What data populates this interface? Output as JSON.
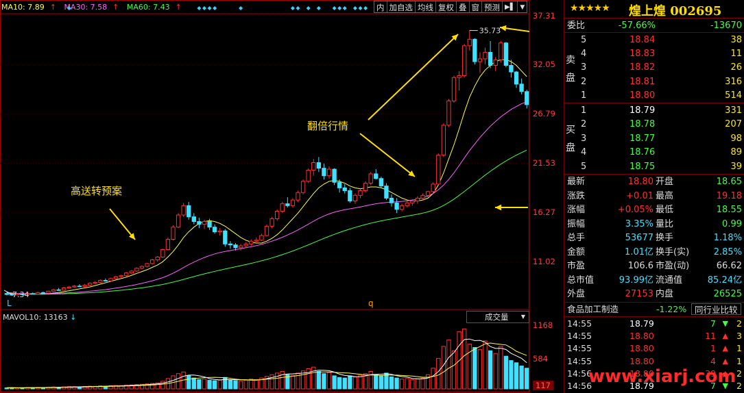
{
  "chart": {
    "ma_legend": [
      {
        "label": "MA10: 7.89",
        "arrow": "↑",
        "color": "#ffff40"
      },
      {
        "label": "MA30: 7.58",
        "arrow": "↑",
        "color": "#ff60ff"
      },
      {
        "label": "MA60: 7.43",
        "arrow": "↑",
        "color": "#40ff40"
      }
    ],
    "toolbar": [
      "内",
      "加自选",
      "均线",
      "复权",
      "叠",
      "窗",
      "预测"
    ],
    "yaxis": [
      {
        "label": "37.31",
        "y": 23
      },
      {
        "label": "32.05",
        "y": 94
      },
      {
        "label": "26.79",
        "y": 166
      },
      {
        "label": "21.53",
        "y": 238
      },
      {
        "label": "16.27",
        "y": 310
      },
      {
        "label": "11.02",
        "y": 382
      }
    ],
    "high_label": "35.73",
    "low_label": "7.34",
    "x_marks": [
      "L",
      "q"
    ],
    "annotations": {
      "a1": "高送转预案",
      "a2": "翻倍行情"
    }
  },
  "chart_data": {
    "type": "candlestick",
    "ylim": [
      5.5,
      37.31
    ],
    "price_ticks": [
      37.31,
      32.05,
      26.79,
      21.53,
      16.27,
      11.02
    ],
    "ohlc": [
      [
        7.6,
        7.7,
        7.4,
        7.5
      ],
      [
        7.5,
        7.6,
        7.34,
        7.45
      ],
      [
        7.45,
        7.6,
        7.4,
        7.55
      ],
      [
        7.55,
        7.6,
        7.4,
        7.5
      ],
      [
        7.5,
        7.7,
        7.45,
        7.6
      ],
      [
        7.6,
        7.7,
        7.5,
        7.55
      ],
      [
        7.55,
        7.8,
        7.5,
        7.7
      ],
      [
        7.7,
        7.8,
        7.6,
        7.65
      ],
      [
        7.65,
        7.9,
        7.6,
        7.85
      ],
      [
        7.85,
        8.1,
        7.8,
        8.0
      ],
      [
        8.0,
        8.2,
        7.9,
        7.95
      ],
      [
        7.95,
        8.3,
        7.9,
        8.2
      ],
      [
        8.2,
        8.4,
        8.1,
        8.3
      ],
      [
        8.3,
        8.5,
        8.2,
        8.4
      ],
      [
        8.4,
        8.6,
        8.3,
        8.35
      ],
      [
        8.35,
        8.6,
        8.3,
        8.5
      ],
      [
        8.5,
        8.8,
        8.4,
        8.7
      ],
      [
        8.7,
        8.9,
        8.6,
        8.8
      ],
      [
        8.8,
        9.1,
        8.7,
        9.0
      ],
      [
        9.0,
        9.2,
        8.9,
        8.95
      ],
      [
        8.95,
        9.3,
        8.9,
        9.2
      ],
      [
        9.2,
        9.5,
        9.1,
        9.4
      ],
      [
        9.4,
        9.6,
        9.3,
        9.5
      ],
      [
        9.5,
        9.9,
        9.4,
        9.8
      ],
      [
        9.8,
        10.1,
        9.7,
        10.0
      ],
      [
        10.0,
        10.4,
        9.9,
        10.3
      ],
      [
        10.3,
        10.6,
        10.2,
        10.5
      ],
      [
        10.5,
        10.9,
        10.4,
        10.8
      ],
      [
        10.8,
        11.3,
        10.7,
        11.2
      ],
      [
        11.2,
        11.6,
        11.0,
        11.5
      ],
      [
        11.5,
        12.4,
        11.4,
        12.3
      ],
      [
        12.3,
        13.6,
        12.2,
        13.4
      ],
      [
        13.4,
        14.9,
        13.3,
        14.7
      ],
      [
        14.7,
        16.2,
        14.6,
        16.0
      ],
      [
        16.0,
        17.3,
        15.8,
        17.0
      ],
      [
        17.0,
        17.4,
        15.5,
        15.8
      ],
      [
        15.8,
        16.2,
        15.0,
        15.3
      ],
      [
        15.3,
        15.7,
        14.6,
        15.0
      ],
      [
        15.0,
        15.5,
        14.5,
        15.3
      ],
      [
        15.3,
        15.6,
        14.4,
        14.7
      ],
      [
        14.7,
        15.0,
        14.0,
        14.2
      ],
      [
        14.2,
        14.6,
        13.8,
        14.3
      ],
      [
        14.3,
        14.5,
        12.6,
        12.9
      ],
      [
        12.9,
        13.2,
        12.4,
        12.8
      ],
      [
        12.8,
        13.0,
        12.2,
        12.5
      ],
      [
        12.5,
        12.9,
        12.2,
        12.7
      ],
      [
        12.7,
        13.1,
        12.5,
        12.9
      ],
      [
        12.9,
        13.4,
        12.7,
        13.2
      ],
      [
        13.2,
        13.6,
        13.0,
        13.3
      ],
      [
        13.3,
        14.0,
        13.2,
        13.8
      ],
      [
        13.8,
        15.0,
        13.7,
        14.8
      ],
      [
        14.8,
        15.8,
        14.6,
        15.6
      ],
      [
        15.6,
        16.6,
        15.4,
        16.4
      ],
      [
        16.4,
        17.4,
        16.2,
        17.2
      ],
      [
        17.2,
        17.9,
        16.8,
        17.0
      ],
      [
        17.0,
        17.8,
        16.8,
        17.6
      ],
      [
        17.6,
        18.6,
        17.4,
        18.4
      ],
      [
        18.4,
        19.8,
        18.2,
        19.6
      ],
      [
        19.6,
        21.0,
        19.4,
        20.8
      ],
      [
        20.8,
        22.0,
        20.2,
        21.6
      ],
      [
        21.6,
        22.2,
        20.6,
        21.0
      ],
      [
        21.0,
        21.5,
        19.8,
        20.2
      ],
      [
        20.2,
        21.2,
        19.9,
        20.9
      ],
      [
        20.9,
        21.0,
        19.2,
        19.5
      ],
      [
        19.5,
        19.8,
        18.4,
        18.9
      ],
      [
        18.9,
        19.3,
        18.3,
        18.6
      ],
      [
        18.6,
        18.9,
        17.3,
        17.5
      ],
      [
        17.5,
        18.3,
        17.2,
        18.1
      ],
      [
        18.1,
        18.8,
        17.8,
        18.6
      ],
      [
        18.6,
        19.6,
        18.4,
        19.4
      ],
      [
        19.4,
        20.6,
        19.2,
        20.4
      ],
      [
        20.4,
        20.9,
        19.8,
        19.9
      ],
      [
        19.9,
        20.1,
        18.9,
        19.1
      ],
      [
        19.1,
        19.4,
        17.6,
        17.8
      ],
      [
        17.8,
        18.2,
        16.9,
        17.3
      ],
      [
        17.3,
        17.8,
        16.2,
        16.6
      ],
      [
        16.6,
        17.2,
        16.4,
        17.0
      ],
      [
        17.0,
        17.6,
        16.8,
        17.3
      ],
      [
        17.3,
        17.7,
        17.0,
        17.5
      ],
      [
        17.5,
        18.0,
        17.2,
        17.8
      ],
      [
        17.8,
        18.3,
        17.6,
        18.1
      ],
      [
        18.1,
        18.6,
        17.9,
        18.5
      ],
      [
        18.5,
        19.5,
        18.4,
        19.3
      ],
      [
        19.3,
        22.6,
        19.2,
        22.4
      ],
      [
        22.4,
        25.8,
        22.2,
        25.6
      ],
      [
        25.6,
        28.4,
        25.4,
        28.2
      ],
      [
        28.2,
        30.9,
        28.0,
        30.7
      ],
      [
        30.7,
        31.4,
        29.3,
        30.9
      ],
      [
        30.9,
        34.3,
        30.7,
        34.1
      ],
      [
        34.1,
        35.73,
        33.6,
        34.8
      ],
      [
        34.8,
        34.9,
        32.1,
        32.4
      ],
      [
        32.4,
        33.4,
        31.2,
        32.7
      ],
      [
        32.7,
        33.9,
        32.1,
        33.4
      ],
      [
        33.4,
        34.6,
        31.7,
        32.0
      ],
      [
        32.0,
        32.9,
        31.4,
        32.6
      ],
      [
        32.6,
        34.6,
        32.3,
        34.4
      ],
      [
        34.4,
        34.5,
        31.8,
        32.0
      ],
      [
        32.0,
        32.6,
        30.7,
        31.3
      ],
      [
        31.3,
        31.4,
        29.6,
        30.0
      ],
      [
        30.0,
        30.6,
        28.9,
        29.2
      ],
      [
        29.2,
        29.4,
        27.4,
        27.8
      ]
    ],
    "ma_series": [
      {
        "name": "MA10",
        "color": "#ffff40",
        "values": [
          7.7,
          7.65,
          7.6,
          7.58,
          7.56,
          7.55,
          7.56,
          7.58,
          7.6,
          7.65,
          7.7,
          7.8,
          7.9,
          8.0,
          8.1,
          8.2,
          8.3,
          8.45,
          8.6,
          8.75,
          8.9,
          9.05,
          9.2,
          9.35,
          9.55,
          9.75,
          9.95,
          10.15,
          10.4,
          10.65,
          11.0,
          11.5,
          12.1,
          12.8,
          13.6,
          14.2,
          14.7,
          15.1,
          15.3,
          15.4,
          15.3,
          15.1,
          14.8,
          14.4,
          14.0,
          13.6,
          13.3,
          13.1,
          13.0,
          13.0,
          13.2,
          13.5,
          13.9,
          14.4,
          15.0,
          15.6,
          16.2,
          16.9,
          17.6,
          18.3,
          18.9,
          19.3,
          19.6,
          19.7,
          19.6,
          19.4,
          19.1,
          18.9,
          18.8,
          18.9,
          19.0,
          19.0,
          18.9,
          18.7,
          18.4,
          18.1,
          17.8,
          17.6,
          17.5,
          17.5,
          17.6,
          17.8,
          18.3,
          19.2,
          20.5,
          22.0,
          23.5,
          25.2,
          27.0,
          28.6,
          29.8,
          30.8,
          31.5,
          32.0,
          32.4,
          32.6,
          32.6,
          32.4,
          32.0,
          31.4,
          30.8
        ]
      },
      {
        "name": "MA30",
        "color": "#ff60ff",
        "values": [
          7.6,
          7.6,
          7.6,
          7.59,
          7.58,
          7.58,
          7.58,
          7.59,
          7.6,
          7.61,
          7.63,
          7.65,
          7.68,
          7.71,
          7.75,
          7.8,
          7.85,
          7.9,
          7.96,
          8.02,
          8.1,
          8.18,
          8.27,
          8.36,
          8.46,
          8.57,
          8.69,
          8.82,
          8.96,
          9.12,
          9.3,
          9.52,
          9.78,
          10.07,
          10.38,
          10.68,
          10.96,
          11.22,
          11.45,
          11.66,
          11.84,
          11.99,
          12.1,
          12.2,
          12.3,
          12.4,
          12.5,
          12.6,
          12.72,
          12.86,
          13.02,
          13.2,
          13.4,
          13.62,
          13.86,
          14.12,
          14.4,
          14.7,
          15.02,
          15.34,
          15.64,
          15.9,
          16.12,
          16.3,
          16.44,
          16.56,
          16.66,
          16.76,
          16.86,
          16.98,
          17.1,
          17.2,
          17.28,
          17.34,
          17.38,
          17.42,
          17.46,
          17.52,
          17.6,
          17.7,
          17.84,
          18.02,
          18.3,
          18.7,
          19.2,
          19.8,
          20.5,
          21.3,
          22.1,
          22.9,
          23.6,
          24.3,
          24.9,
          25.5,
          26.0,
          26.5,
          26.9,
          27.3,
          27.6,
          27.9,
          28.1
        ]
      },
      {
        "name": "MA60",
        "color": "#40ff40",
        "values": [
          7.55,
          7.55,
          7.55,
          7.54,
          7.53,
          7.53,
          7.53,
          7.53,
          7.54,
          7.55,
          7.56,
          7.57,
          7.59,
          7.61,
          7.63,
          7.66,
          7.69,
          7.72,
          7.76,
          7.8,
          7.85,
          7.9,
          7.95,
          8.01,
          8.07,
          8.14,
          8.21,
          8.29,
          8.38,
          8.47,
          8.57,
          8.69,
          8.82,
          8.96,
          9.11,
          9.26,
          9.41,
          9.56,
          9.7,
          9.84,
          9.97,
          10.1,
          10.22,
          10.34,
          10.46,
          10.58,
          10.7,
          10.83,
          10.96,
          11.1,
          11.25,
          11.41,
          11.58,
          11.76,
          11.95,
          12.15,
          12.36,
          12.58,
          12.81,
          13.04,
          13.27,
          13.5,
          13.72,
          13.93,
          14.13,
          14.32,
          14.5,
          14.67,
          14.83,
          14.98,
          15.12,
          15.25,
          15.37,
          15.48,
          15.58,
          15.68,
          15.78,
          15.88,
          15.98,
          16.08,
          16.2,
          16.34,
          16.52,
          16.75,
          17.02,
          17.34,
          17.7,
          18.1,
          18.52,
          18.96,
          19.4,
          19.84,
          20.27,
          20.68,
          21.07,
          21.44,
          21.78,
          22.1,
          22.4,
          22.68,
          22.94
        ]
      }
    ],
    "volume": {
      "ylim": [
        0,
        1168
      ],
      "ticks": [
        1168,
        584,
        117
      ],
      "values": [
        20,
        22,
        18,
        20,
        25,
        22,
        28,
        25,
        30,
        35,
        30,
        38,
        42,
        40,
        38,
        45,
        50,
        48,
        55,
        50,
        58,
        62,
        60,
        68,
        72,
        80,
        85,
        92,
        100,
        110,
        140,
        190,
        240,
        280,
        310,
        240,
        200,
        170,
        180,
        160,
        150,
        160,
        210,
        170,
        150,
        140,
        160,
        180,
        170,
        200,
        230,
        260,
        290,
        320,
        260,
        250,
        290,
        330,
        370,
        400,
        320,
        280,
        300,
        240,
        210,
        200,
        240,
        220,
        250,
        280,
        320,
        260,
        240,
        290,
        220,
        200,
        180,
        190,
        170,
        180,
        200,
        260,
        380,
        560,
        780,
        900,
        700,
        1050,
        1100,
        820,
        760,
        720,
        880,
        700,
        650,
        780,
        600,
        520,
        480,
        420,
        380
      ],
      "ma_vol": "13163"
    }
  },
  "vol": {
    "legend": "MAVOL10: 13163",
    "arrow": "↓",
    "dropdown": "成交量",
    "arrowdd": "▼"
  },
  "quote": {
    "stars": "★★★★★",
    "name": "煌上煌 002695",
    "weibi": {
      "label": "委比",
      "pct": "-57.66%",
      "val": "-13670"
    },
    "sell_label": [
      "卖",
      "盘"
    ],
    "buy_label": [
      "买",
      "盘"
    ],
    "sell": [
      {
        "n": "5",
        "p": "18.84",
        "v": "38"
      },
      {
        "n": "4",
        "p": "18.83",
        "v": "11"
      },
      {
        "n": "3",
        "p": "18.82",
        "v": "26"
      },
      {
        "n": "2",
        "p": "18.81",
        "v": "316"
      },
      {
        "n": "1",
        "p": "18.80",
        "v": "514"
      }
    ],
    "buy": [
      {
        "n": "1",
        "p": "18.79",
        "v": "331"
      },
      {
        "n": "2",
        "p": "18.78",
        "v": "207"
      },
      {
        "n": "3",
        "p": "18.77",
        "v": "98"
      },
      {
        "n": "4",
        "p": "18.76",
        "v": "89"
      },
      {
        "n": "5",
        "p": "18.75",
        "v": "39"
      }
    ],
    "stats": [
      {
        "l1": "最新",
        "v1": "18.80",
        "c1": "#ff3030",
        "l2": "开盘",
        "v2": "18.65",
        "c2": "#40ff40"
      },
      {
        "l1": "涨跌",
        "v1": "+0.01",
        "c1": "#ff3030",
        "l2": "最高",
        "v2": "19.18",
        "c2": "#ff3030"
      },
      {
        "l1": "涨幅",
        "v1": "+0.05%",
        "c1": "#ff3030",
        "l2": "最低",
        "v2": "18.55",
        "c2": "#40ff40"
      },
      {
        "l1": "振幅",
        "v1": "3.35%",
        "c1": "#40e0ff",
        "l2": "量比",
        "v2": "0.99",
        "c2": "#40ff40"
      },
      {
        "l1": "总手",
        "v1": "53677",
        "c1": "#40e0ff",
        "l2": "换手",
        "v2": "1.18%",
        "c2": "#40e0ff"
      },
      {
        "l1": "金额",
        "v1": "1.01亿",
        "c1": "#40e0ff",
        "l2": "换手(实)",
        "v2": "2.85%",
        "c2": "#40e0ff"
      },
      {
        "l1": "市盈",
        "v1": "106.6",
        "c1": "#dddddd",
        "l2": "市盈(动)",
        "v2": "66.62",
        "c2": "#dddddd"
      },
      {
        "l1": "总市值",
        "v1": "93.99亿",
        "c1": "#40e0ff",
        "l2": "流通值",
        "v2": "85.24亿",
        "c2": "#40e0ff"
      },
      {
        "l1": "外盘",
        "v1": "27153",
        "c1": "#ff3030",
        "l2": "内盘",
        "v2": "26525",
        "c2": "#40ff40"
      }
    ],
    "industry": {
      "name": "食品加工制造",
      "pct": "-1.22%",
      "compare": "同行业比较"
    },
    "ticks": [
      {
        "t": "14:55",
        "p": "18.79",
        "pc": "#ffffff",
        "v": "7",
        "dir": "down",
        "n": "2"
      },
      {
        "t": "14:55",
        "p": "18.80",
        "pc": "#ff3030",
        "v": "11",
        "dir": "up",
        "n": "3"
      },
      {
        "t": "14:55",
        "p": "18.80",
        "pc": "#ff3030",
        "v": "1",
        "dir": "up",
        "n": "1"
      },
      {
        "t": "14:55",
        "p": "18.80",
        "pc": "#ff3030",
        "v": "4",
        "dir": "up",
        "n": "1"
      },
      {
        "t": "14:56",
        "p": "18.80",
        "pc": "#ff3030",
        "v": "39",
        "dir": "up",
        "n": "2"
      },
      {
        "t": "14:56",
        "p": "18.79",
        "pc": "#ffffff",
        "v": "7",
        "dir": "down",
        "n": "2"
      }
    ]
  },
  "watermark": "www.xiarj.com",
  "colors": {
    "up": "#ff3030",
    "down": "#40e0ff",
    "frame": "#7a0000",
    "yellow": "#ffe000"
  }
}
